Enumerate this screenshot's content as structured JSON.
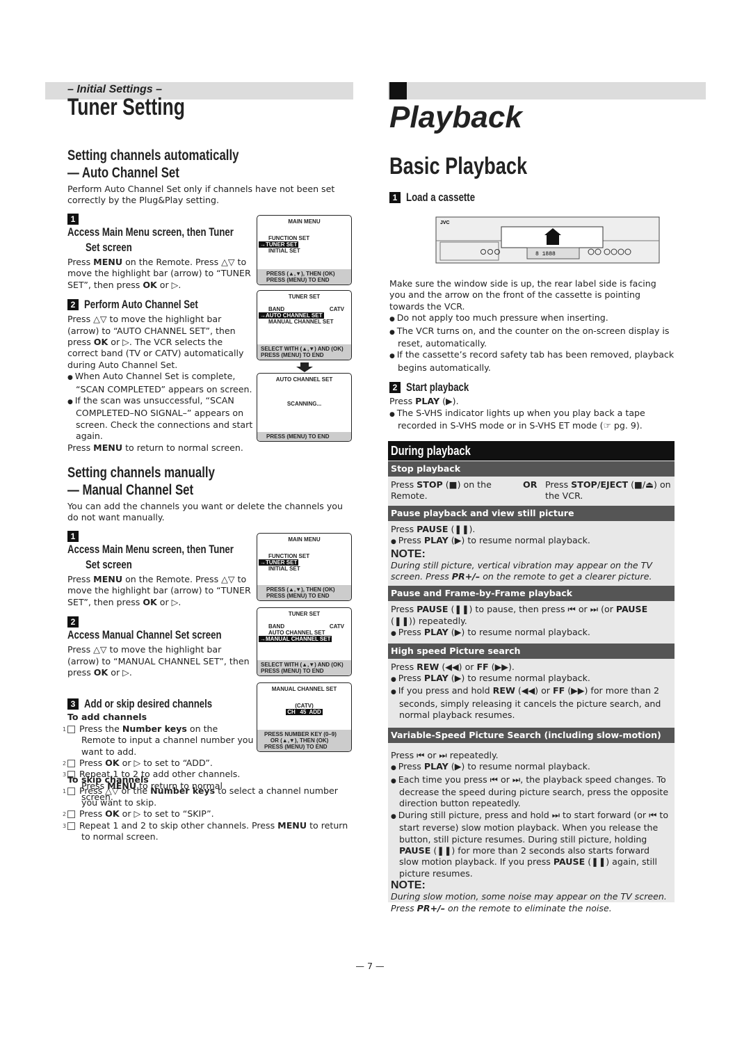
{
  "left": {
    "band_label": "– Initial Settings –",
    "title": "Tuner Setting",
    "auto": {
      "heading1": "Setting channels automatically",
      "heading2": "— Auto Channel Set",
      "intro": "Perform Auto Channel Set only if channels have not been set correctly by the Plug&Play setting.",
      "step1_num": "1",
      "step1_title_a": "Access Main Menu screen, then Tuner",
      "step1_title_b": "Set screen",
      "step1_text": "Press **MENU** on the Remote. Press △▽ to move the highlight bar (arrow) to “TUNER SET”, then press **OK** or ▷.",
      "step2_num": "2",
      "step2_title": "Perform Auto Channel Set",
      "step2_text": "Press △▽ to move the highlight bar (arrow) to “AUTO CHANNEL SET”, then press **OK** or ▷. The VCR selects the correct band (TV or CATV) automatically during Auto Channel Set.",
      "bullet1": "When Auto Channel Set is complete, “SCAN COMPLETED” appears on screen.",
      "bullet2": "If the scan was unsuccessful, “SCAN COMPLETED–NO SIGNAL–” appears on screen. Check the connections and start again.",
      "return": "Press **MENU** to return to normal screen."
    },
    "manual": {
      "heading1": "Setting channels manually",
      "heading2": "— Manual Channel Set",
      "intro": "You can add the channels you want or delete the channels you do not want manually.",
      "step1_num": "1",
      "step1_title_a": "Access Main Menu screen, then Tuner",
      "step1_title_b": "Set screen",
      "step1_text": "Press **MENU** on the Remote. Press △▽ to move the highlight bar (arrow) to “TUNER SET”, then press **OK** or ▷.",
      "step2_num": "2",
      "step2_title": "Access Manual Channel Set screen",
      "step2_text": "Press △▽ to move the highlight bar (arrow) to “MANUAL CHANNEL SET”, then press **OK** or ▷.",
      "step3_num": "3",
      "step3_title": "Add or skip desired channels",
      "add_title": "To add channels",
      "add_items": [
        {
          "n": "1",
          "t": "Press the **Number keys** on the Remote to input a channel number you want to add."
        },
        {
          "n": "2",
          "t": "Press **OK** or ▷ to set to “ADD”."
        },
        {
          "n": "3",
          "t": "Repeat 1 to 2 to add other channels. Press **MENU** to return to normal screen."
        }
      ],
      "skip_title": "To skip channels",
      "skip_items": [
        {
          "n": "1",
          "t": "Press △▽ or the **Number keys** to select a channel number you want to skip."
        },
        {
          "n": "2",
          "t": "Press **OK** or ▷ to set to “SKIP”."
        },
        {
          "n": "3",
          "t": "Repeat 1 and 2 to skip other channels. Press **MENU** to return to normal screen."
        }
      ]
    },
    "screens": {
      "main_menu": {
        "title": "MAIN MENU",
        "items": [
          "FUNCTION SET",
          "→TUNER SET",
          "INITIAL SET"
        ],
        "foot": [
          "PRESS (▲,▼), THEN (OK)",
          "PRESS (MENU) TO END"
        ]
      },
      "tuner_auto": {
        "title": "TUNER SET",
        "band": "BAND",
        "band_val": "CATV",
        "items": [
          "→AUTO CHANNEL SET",
          "MANUAL CHANNEL SET"
        ],
        "foot": [
          "SELECT WITH (▲,▼) AND (OK)",
          "PRESS (MENU) TO END"
        ]
      },
      "auto_scan": {
        "title": "AUTO CHANNEL SET",
        "body": "SCANNING...",
        "foot": [
          "PRESS (MENU) TO END"
        ]
      },
      "tuner_manual": {
        "title": "TUNER SET",
        "band": "BAND",
        "band_val": "CATV",
        "items": [
          "AUTO CHANNEL SET",
          "→MANUAL CHANNEL SET"
        ],
        "foot": [
          "SELECT WITH (▲,▼) AND (OK)",
          "PRESS (MENU) TO END"
        ]
      },
      "manual_set": {
        "title": "MANUAL CHANNEL SET",
        "band": "(CATV)",
        "ch": "CH   45  ADD",
        "foot": [
          "PRESS NUMBER KEY (0–9)",
          "    OR (▲,▼), THEN (OK)",
          "PRESS (MENU) TO END"
        ]
      }
    }
  },
  "right": {
    "title": "Playback",
    "subtitle": "Basic Playback",
    "step1_num": "1",
    "step1_title": "Load a cassette",
    "vcr": {
      "brand": "JVC",
      "display": "8 1888"
    },
    "load_text": "Make sure the window side is up, the rear label side is facing you and the arrow on the front of the cassette is pointing towards the VCR.",
    "load_bullets": [
      "Do not apply too much pressure when inserting.",
      "The VCR turns on, and the counter on the on-screen display is reset, automatically.",
      "If the cassette’s record safety tab has been removed, playback begins automatically."
    ],
    "step2_num": "2",
    "step2_title": "Start playback",
    "start_text": "Press **PLAY** (▶).",
    "start_bullet": "The S-VHS indicator lights up when you play back a tape recorded in S-VHS mode or in S-VHS ET mode (☞ pg. 9).",
    "during": {
      "title": "During playback",
      "stop": {
        "title": "Stop playback",
        "a": "Press **STOP** (■) on the Remote.",
        "or": "OR",
        "b": "Press **STOP/EJECT** (■/⏏) on the VCR."
      },
      "pause": {
        "title": "Pause playback and view still picture",
        "text": "Press **PAUSE** (❚❚).",
        "bullet": "Press **PLAY** (▶) to resume normal playback.",
        "note_label": "NOTE:",
        "note": "During still picture, vertical vibration may appear on the TV screen. Press **PR+/–** on the remote to get a clearer picture."
      },
      "frame": {
        "title": "Pause and Frame-by-Frame playback",
        "text": "Press **PAUSE** (❚❚) to pause, then press ⏮ or ⏭ (or **PAUSE** (❚❚)) repeatedly.",
        "bullet": "Press **PLAY** (▶) to resume normal playback."
      },
      "search": {
        "title": "High speed Picture search",
        "text": "Press **REW** (◀◀) or **FF** (▶▶).",
        "bullets": [
          "Press **PLAY** (▶) to resume normal playback.",
          "If you press and hold **REW** (◀◀) or **FF** (▶▶) for more than 2 seconds, simply releasing it cancels the picture search, and normal playback resumes."
        ]
      },
      "variable": {
        "title": "Variable-Speed Picture Search (including slow-motion)",
        "text": "Press ⏮ or ⏭ repeatedly.",
        "bullets": [
          "Press **PLAY** (▶) to resume normal playback.",
          "Each time you press ⏮ or ⏭, the playback speed changes. To decrease the speed during picture search, press the opposite direction button repeatedly.",
          "During still picture, press and hold ⏭ to start forward (or ⏮ to start reverse) slow motion playback. When you release the button, still picture resumes. During still picture, holding **PAUSE** (❚❚) for more than 2 seconds also starts forward slow motion playback. If you press **PAUSE** (❚❚) again, still picture resumes."
        ],
        "note_label": "NOTE:",
        "note": "During slow motion, some noise may appear on the TV screen. Press **PR+/–** on the remote to eliminate the noise."
      }
    }
  },
  "page_number": "— 7 —"
}
